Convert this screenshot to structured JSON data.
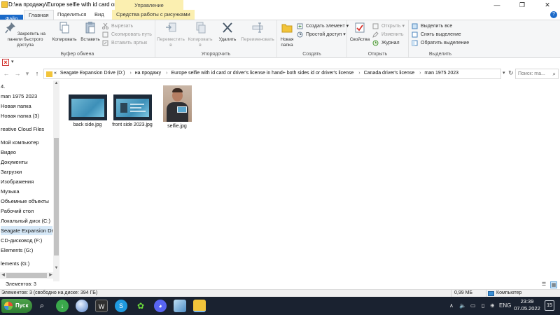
{
  "window": {
    "title": "D:\\на продажу\\Europe selfie with id card or ...",
    "context_tab_title": "Управление",
    "controls": {
      "minimize": "—",
      "maximize": "❐",
      "close": "✕"
    }
  },
  "tabs": {
    "file": "Файл",
    "home": "Главная",
    "share": "Поделиться",
    "view": "Вид",
    "picture_tools": "Средства работы с рисунками",
    "help": "?"
  },
  "ribbon": {
    "clipboard": {
      "label": "Буфер обмена",
      "pin": "Закрепить на панели быстрого доступа",
      "copy": "Копировать",
      "paste": "Вставить",
      "cut": "Вырезать",
      "copy_path": "Скопировать путь",
      "paste_shortcut": "Вставить ярлык"
    },
    "organize": {
      "label": "Упорядочить",
      "move_to": "Переместить в",
      "copy_to": "Копировать в",
      "delete": "Удалить",
      "rename": "Переименовать"
    },
    "new": {
      "label": "Создать",
      "new_folder": "Новая папка",
      "new_item": "Создать элемент",
      "easy_access": "Простой доступ"
    },
    "open": {
      "label": "Открыть",
      "properties": "Свойства",
      "open": "Открыть",
      "edit": "Изменить",
      "history": "Журнал"
    },
    "select": {
      "label": "Выделить",
      "select_all": "Выделить все",
      "select_none": "Снять выделение",
      "invert": "Обратить выделение"
    }
  },
  "address": {
    "crumbs": [
      "«",
      "Seagate Expansion Drive (D:)",
      "на продажу",
      "Europe selfie with id card or driver's license in hand+ both sides id or driver's license",
      "Canada driver's license",
      "man 1975 2023"
    ],
    "search_placeholder": "Поиск: ma..."
  },
  "navpane": {
    "items": [
      "4.",
      "man 1975 2023",
      "Новая папка",
      "Новая папка (3)",
      "reative Cloud Files",
      "Мой компьютер",
      "Видео",
      "Документы",
      "Загрузки",
      "Изображения",
      "Музыка",
      "Объемные объекты",
      "Рабочий стол",
      "Локальный диск (C:)",
      "Seagate Expansion Drive",
      "CD-дисковод (F:)",
      "Elements (G:)",
      "lements (G:)"
    ]
  },
  "files": [
    {
      "name": "back side.jpg"
    },
    {
      "name": "front side 2023.jpg"
    },
    {
      "name": "selfie.jpg"
    }
  ],
  "status": {
    "count": "Элементов: 3",
    "summary": "Элементов: 3 (свободно на диске: 394 ГБ)",
    "size": "0,99 МБ",
    "location": "Компьютер"
  },
  "taskbar": {
    "start": "Пуск",
    "language": "ENG",
    "time": "23:39",
    "date": "07.05.2022",
    "notifications": "15"
  },
  "colors": {
    "file_tab": "#1b6ac9",
    "context_tab": "#fbefb0",
    "taskbar": "#1a2230",
    "selection": "#d6e8f7"
  }
}
